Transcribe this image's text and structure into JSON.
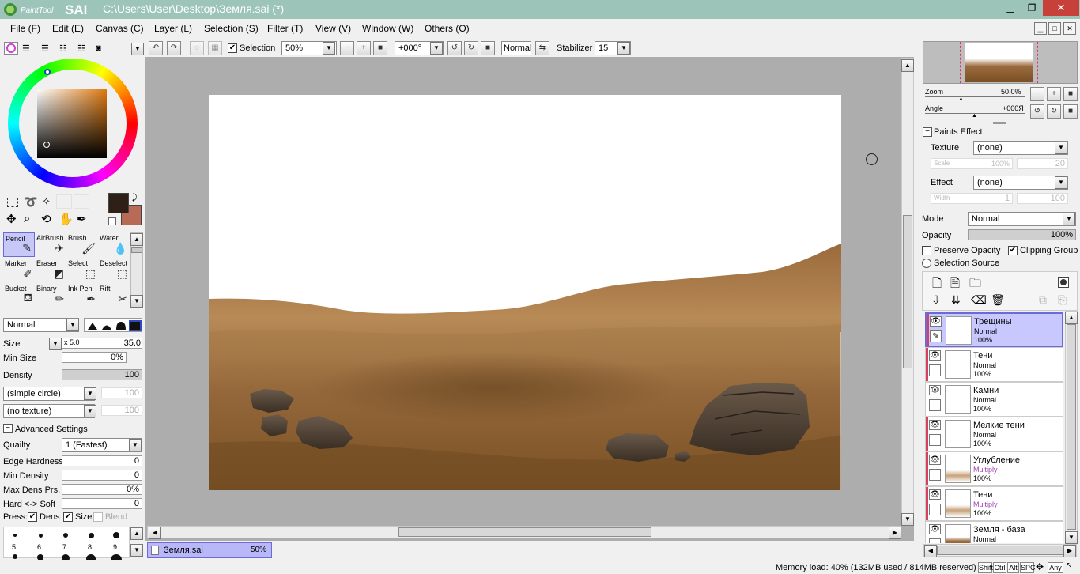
{
  "app": {
    "logo_text": "PaintTool SAI",
    "title": "C:\\Users\\User\\Desktop\\Земля.sai (*)"
  },
  "menu": [
    "File (F)",
    "Edit (E)",
    "Canvas (C)",
    "Layer (L)",
    "Selection (S)",
    "Filter (T)",
    "View (V)",
    "Window (W)",
    "Others (O)"
  ],
  "toolbar": {
    "selection_label": "Selection",
    "selection_checked": true,
    "zoom": "50%",
    "angle": "+000°",
    "blend": "Normal",
    "stabilizer_label": "Stabilizer",
    "stabilizer": "15"
  },
  "colors": {
    "primary": "#2e2016",
    "secondary": "#b86a56",
    "accent_layer": "#c8c8ff"
  },
  "tools": [
    {
      "label": "Pencil",
      "icon": "pencil-icon",
      "selected": true
    },
    {
      "label": "AirBrush",
      "icon": "airbrush-icon"
    },
    {
      "label": "Brush",
      "icon": "brush-icon"
    },
    {
      "label": "Water",
      "icon": "water-icon"
    },
    {
      "label": "Marker",
      "icon": "marker-icon"
    },
    {
      "label": "Eraser",
      "icon": "eraser-icon"
    },
    {
      "label": "Select",
      "icon": "select-icon"
    },
    {
      "label": "Deselect",
      "icon": "deselect-icon"
    },
    {
      "label": "Bucket",
      "icon": "bucket-icon"
    },
    {
      "label": "Binary",
      "icon": "binary-icon"
    },
    {
      "label": "Ink Pen",
      "icon": "inkpen-icon"
    },
    {
      "label": "Rift",
      "icon": "rift-icon"
    }
  ],
  "brush": {
    "mode": "Normal",
    "size_label": "Size",
    "size_mult": "x 5.0",
    "size": "35.0",
    "min_size_label": "Min Size",
    "min_size": "0%",
    "density_label": "Density",
    "density": "100",
    "shape": "(simple circle)",
    "shape_value": "100",
    "texture": "(no texture)",
    "texture_value": "100",
    "advanced_label": "Advanced Settings",
    "quality_label": "Quailty",
    "quality": "1 (Fastest)",
    "edge_hardness_label": "Edge Hardness",
    "edge_hardness": "0",
    "min_density_label": "Min Density",
    "min_density": "0",
    "max_dens_label": "Max Dens Prs.",
    "max_dens": "0%",
    "hard_soft_label": "Hard <-> Soft",
    "hard_soft": "0",
    "press_label": "Press:",
    "press_dens": "Dens",
    "press_size": "Size",
    "press_blend": "Blend"
  },
  "brush_sizes": [
    "5",
    "6",
    "7",
    "8",
    "9"
  ],
  "document_tab": {
    "name": "Земля.sai",
    "zoom": "50%"
  },
  "navigator": {
    "zoom_label": "Zoom",
    "zoom": "50.0%",
    "angle_label": "Angle",
    "angle": "+000Я"
  },
  "paints_effect": {
    "header": "Paints Effect",
    "texture_label": "Texture",
    "texture": "(none)",
    "scale_label": "Scale",
    "scale": "100%",
    "scale_value": "20",
    "effect_label": "Effect",
    "effect": "(none)",
    "width_label": "Width",
    "width": "1",
    "width_value": "100"
  },
  "layer_props": {
    "mode_label": "Mode",
    "mode": "Normal",
    "opacity_label": "Opacity",
    "opacity": "100%",
    "preserve_opacity": "Preserve Opacity",
    "clipping_group": "Clipping Group",
    "selection_source": "Selection Source"
  },
  "layers": [
    {
      "name": "Трещины",
      "mode": "Normal",
      "opacity": "100%",
      "selected": true,
      "clipped": true,
      "multiply": false
    },
    {
      "name": "Тени",
      "mode": "Normal",
      "opacity": "100%",
      "selected": false,
      "clipped": true,
      "multiply": false
    },
    {
      "name": "Камни",
      "mode": "Normal",
      "opacity": "100%",
      "selected": false,
      "clipped": false,
      "multiply": false
    },
    {
      "name": "Мелкие тени",
      "mode": "Normal",
      "opacity": "100%",
      "selected": false,
      "clipped": true,
      "multiply": false
    },
    {
      "name": "Углубление",
      "mode": "Multiply",
      "opacity": "100%",
      "selected": false,
      "clipped": true,
      "multiply": true
    },
    {
      "name": "Тени",
      "mode": "Multiply",
      "opacity": "100%",
      "selected": false,
      "clipped": true,
      "multiply": true
    },
    {
      "name": "Земля - база",
      "mode": "Normal",
      "opacity": "",
      "selected": false,
      "clipped": false,
      "multiply": false
    }
  ],
  "status": {
    "memory": "Memory load: 40% (132MB used / 814MB reserved)",
    "keys": [
      "Shift",
      "Ctrl",
      "Alt",
      "SPC",
      "Any"
    ]
  }
}
